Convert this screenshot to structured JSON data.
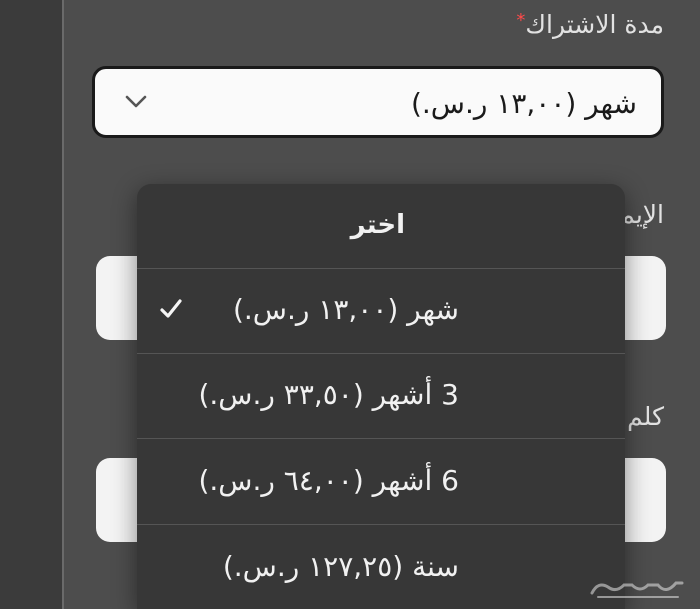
{
  "form": {
    "duration_label": "مدة الاشتراك",
    "required_mark": "*",
    "selected_value": "شهر (١٣,٠٠ ر.س.)",
    "email_label_partial": "الإيم",
    "password_label_partial": "كلم"
  },
  "dropdown": {
    "selected_index": 1,
    "options": [
      {
        "label": "اختر"
      },
      {
        "label": "شهر (١٣,٠٠ ر.س.)"
      },
      {
        "label": "3 أشهر (٣٣,٥٠ ر.س.)"
      },
      {
        "label": "6 أشهر (٦٤,٠٠ ر.س.)"
      },
      {
        "label": "سنة (١٢٧,٢٥ ر.س.)"
      }
    ]
  },
  "watermark": {
    "name": "haraj-logo-watermark"
  },
  "colors": {
    "background": "#4d4d4d",
    "menu": "#373737",
    "field": "#fafafa",
    "required": "#ff4a4a"
  }
}
